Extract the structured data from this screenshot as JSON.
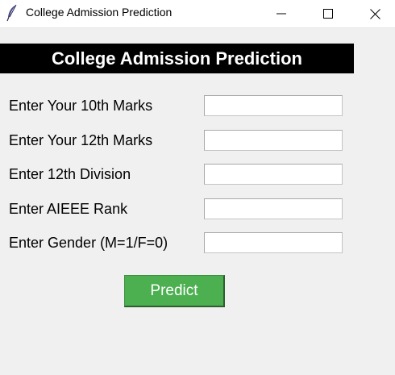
{
  "window": {
    "title": "College Admission Prediction",
    "icon": "feather-icon",
    "controls": [
      "minimize-icon",
      "maximize-icon",
      "close-icon"
    ]
  },
  "heading": "College Admission Prediction",
  "form": {
    "fields": [
      {
        "label": "Enter Your 10th Marks",
        "value": ""
      },
      {
        "label": "Enter Your 12th Marks",
        "value": ""
      },
      {
        "label": "Enter 12th Division",
        "value": ""
      },
      {
        "label": "Enter AIEEE Rank",
        "value": ""
      },
      {
        "label": "Enter Gender (M=1/F=0)",
        "value": ""
      }
    ],
    "submit_label": "Predict"
  },
  "colors": {
    "heading_bg": "#000000",
    "heading_text": "#ffffff",
    "button_bg": "#4caf50",
    "button_text": "#ffffff",
    "window_bg": "#f0f0f0"
  }
}
